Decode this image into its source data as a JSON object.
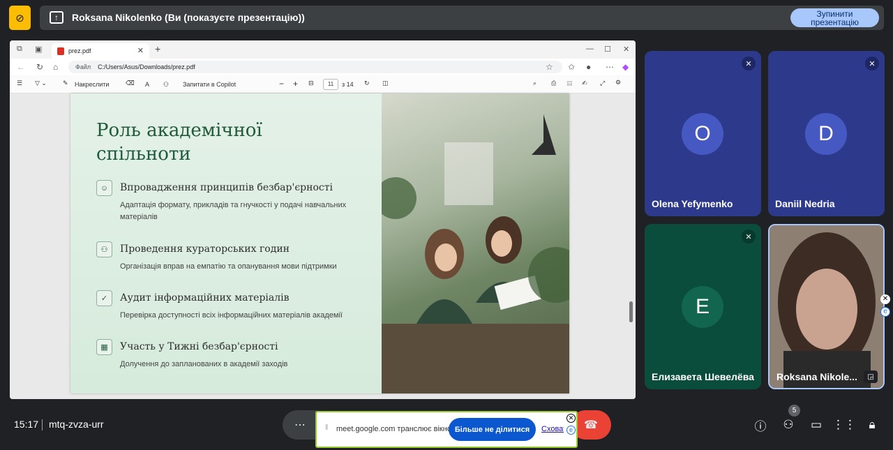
{
  "banner": {
    "title": "Roksana Nikolenko (Ви (показуєте презентацію))",
    "stop_button": "Зупинити презентацію"
  },
  "browser": {
    "tab_title": "prez.pdf",
    "url_label": "Файл",
    "url": "C:/Users/Asus/Downloads/prez.pdf"
  },
  "pdf_toolbar": {
    "draw": "Накреслити",
    "copilot": "Запитати в Copilot",
    "page": "11",
    "of_pages": "з 14"
  },
  "slide": {
    "title": "Роль академічної спільноти",
    "items": [
      {
        "heading": "Впровадження принципів безбар'єрності",
        "desc": "Адаптація формату, прикладів та гнучкості у подачі навчальних матеріалів"
      },
      {
        "heading": "Проведення кураторських годин",
        "desc": "Організація вправ на емпатію та опанування мови підтримки"
      },
      {
        "heading": "Аудит інформаційних матеріалів",
        "desc": "Перевірка доступності всіх інформаційних матеріалів академії"
      },
      {
        "heading": "Участь у Тижні безбар'єрності",
        "desc": "Долучення до запланованих в академії заходів"
      }
    ]
  },
  "participants": [
    {
      "name": "Olena Yefymenko",
      "initial": "O",
      "color": "#2d3a8c"
    },
    {
      "name": "Daniil Nedria",
      "initial": "D",
      "color": "#2d3a8c"
    },
    {
      "name": "Елизавета Шевелёва",
      "initial": "E",
      "color": "#0b4d3c"
    },
    {
      "name": "Roksana Nikole...",
      "initial": "",
      "color": "#4a4a4a"
    }
  ],
  "bottom": {
    "time": "15:17",
    "meeting_code": "mtq-zvza-urr",
    "people_count": "5"
  },
  "share_bar": {
    "text": "meet.google.com транслює вікно.",
    "stop_button": "Більше не ділитися",
    "hide_link": "Сховати"
  },
  "colors": {
    "accent": "#a8c7fa",
    "hangup": "#ea4335",
    "slide_green": "#1f5a3a"
  }
}
